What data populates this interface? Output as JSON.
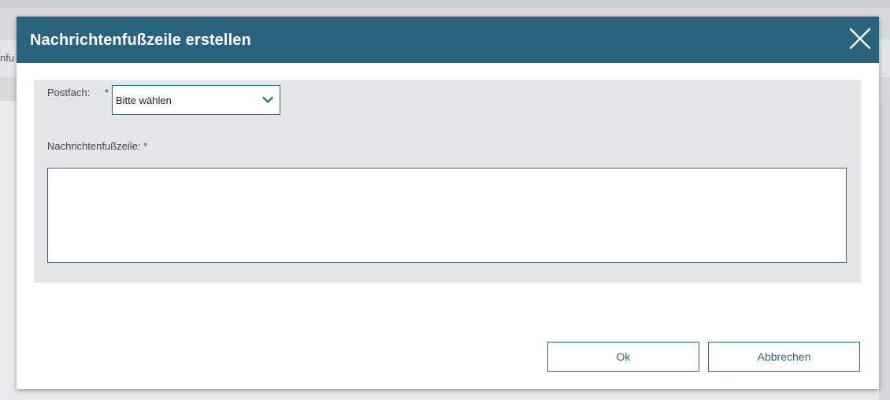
{
  "background": {
    "cut_text": "nfu"
  },
  "dialog": {
    "title": "Nachrichtenfußzeile erstellen",
    "close_icon": "close-icon",
    "form": {
      "postfach_label": "Postfach:",
      "postfach_required": "*",
      "postfach_select": {
        "value": "Bitte wählen",
        "icon": "chevron-down-icon"
      },
      "footer_label": "Nachrichtenfußzeile: *",
      "footer_value": ""
    },
    "buttons": {
      "ok_label": "Ok",
      "cancel_label": "Abbrechen"
    }
  },
  "colors": {
    "header": "#29647f",
    "panel": "#e4e7ea",
    "border": "#2d6680"
  }
}
